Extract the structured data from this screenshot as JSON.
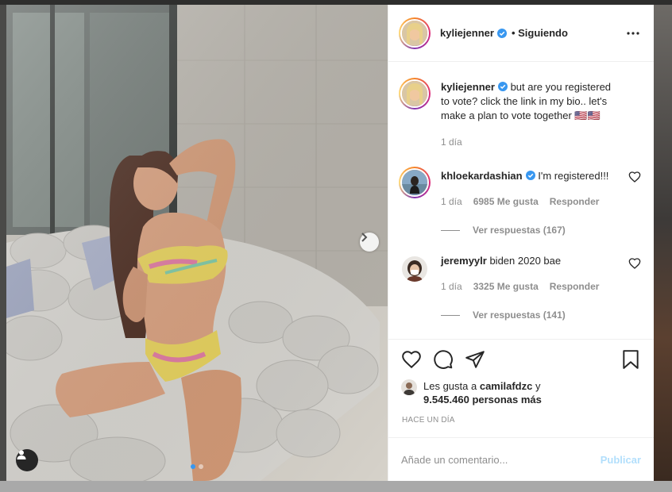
{
  "post": {
    "author": "kyliejenner",
    "follow_status": "• Siguiendo",
    "caption": "but are you registered to vote? click the link in my bio.. let's make a plan to vote together 🇺🇸🇺🇸",
    "caption_time": "1 día",
    "photo_count": 2,
    "active_photo": 1
  },
  "comments": [
    {
      "user": "khloekardashian",
      "verified": true,
      "text": "I'm registered!!!",
      "time": "1 día",
      "likes": "6985 Me gusta",
      "reply_label": "Responder",
      "view_replies": "Ver respuestas (167)"
    },
    {
      "user": "jeremyylr",
      "verified": false,
      "text": "biden 2020 bae",
      "time": "1 día",
      "likes": "3325 Me gusta",
      "reply_label": "Responder",
      "view_replies": "Ver respuestas (141)"
    }
  ],
  "likes": {
    "prefix": "Les gusta a",
    "liker": "camilafdzc",
    "conj": "y",
    "others": "9.545.460 personas más"
  },
  "date": "HACE UN DÍA",
  "comment_box": {
    "placeholder": "Añade un comentario...",
    "publish_label": "Publicar"
  },
  "colors": {
    "verified_blue": "#3897f0",
    "publish_disabled": "#b2dffc",
    "meta_gray": "#8e8e8e"
  }
}
